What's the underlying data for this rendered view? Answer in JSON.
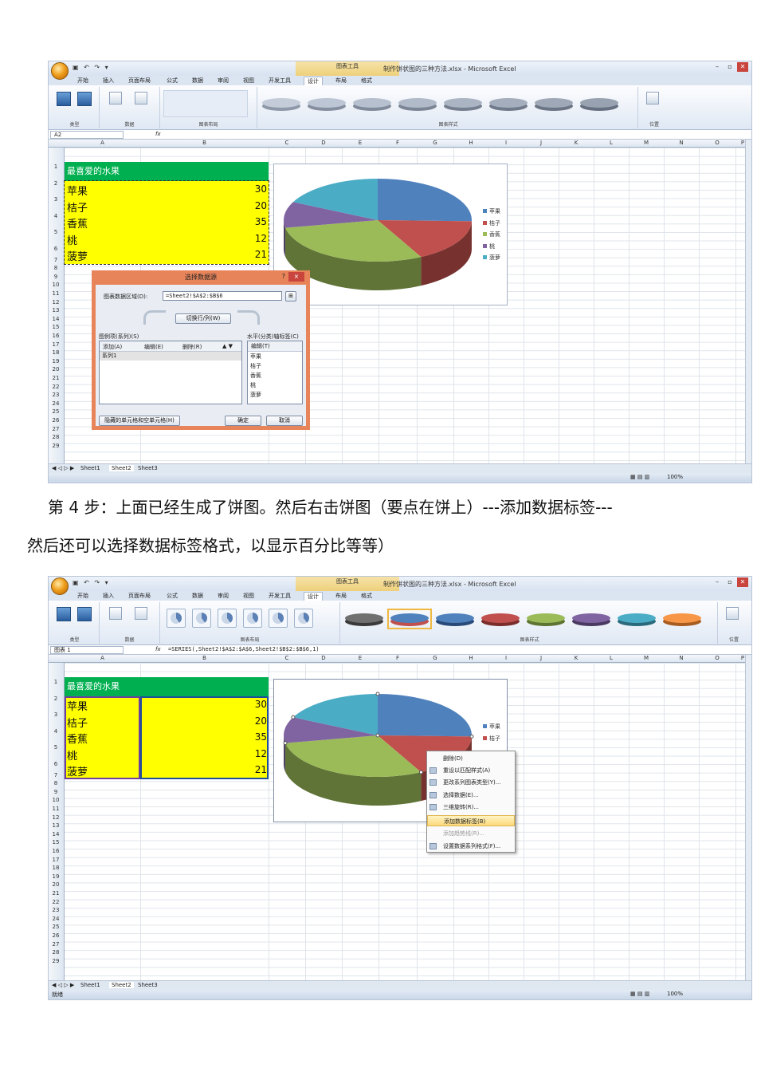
{
  "caption": {
    "line1": "第 4 步：上面已经生成了饼图。然后右击饼图（要点在饼上）---添加数据标签---",
    "line2": "然后还可以选择数据标签格式，以显示百分比等等）"
  },
  "excel": {
    "window_title": "制作饼状图的三种方法.xlsx - Microsoft Excel",
    "context_tool": "图表工具",
    "tabs": [
      "开始",
      "插入",
      "页面布局",
      "公式",
      "数据",
      "审阅",
      "视图",
      "开发工具",
      "设计",
      "布局",
      "格式"
    ],
    "active_tab": "设计",
    "ribbon_groups": [
      "类型",
      "数据",
      "图表布局",
      "图表样式",
      "位置"
    ],
    "ribbon_buttons": {
      "change_type": "更改图表类型",
      "save_template": "另存为模板",
      "switch_rowcol": "切换行/列",
      "select_data": "选择数据",
      "move_chart": "移动图表"
    },
    "columns": [
      "A",
      "B",
      "C",
      "D",
      "E",
      "F",
      "G",
      "H",
      "I",
      "J",
      "K",
      "L",
      "M",
      "N",
      "O",
      "P"
    ],
    "rows": [
      "1",
      "2",
      "3",
      "4",
      "5",
      "6",
      "7",
      "8",
      "9",
      "10",
      "11",
      "12",
      "13",
      "14",
      "15",
      "16",
      "17",
      "18",
      "19",
      "20",
      "21",
      "22",
      "23",
      "24",
      "25",
      "26",
      "27",
      "28",
      "29"
    ],
    "table_title": "最喜爱的水果",
    "fruits": [
      {
        "name": "苹果",
        "value": "30"
      },
      {
        "name": "桔子",
        "value": "20"
      },
      {
        "name": "香蕉",
        "value": "35"
      },
      {
        "name": "桃",
        "value": "12"
      },
      {
        "name": "菠萝",
        "value": "21"
      }
    ],
    "sheets": [
      "Sheet1",
      "Sheet2",
      "Sheet3"
    ],
    "status_ready": "就绪",
    "zoom": "100%",
    "colors": {
      "title_green": "#00b050",
      "data_yellow": "#ffff00",
      "accent": "#2a5d9e"
    }
  },
  "shot1": {
    "name_box": "A2",
    "formula": "",
    "legend": [
      "苹果",
      "桔子",
      "香蕉",
      "桃",
      "菠萝"
    ],
    "dialog": {
      "title": "选择数据源",
      "help": "?",
      "close": "×",
      "range_label": "图表数据区域(D):",
      "range_value": "=Sheet2!$A$2:$B$6",
      "switch_button": "切换行/列(W)",
      "series_label": "图例项(系列)(S)",
      "axis_label": "水平(分类)轴标签(C)",
      "add": "添加(A)",
      "edit": "编辑(E)",
      "delete": "删除(R)",
      "axis_edit": "编辑(T)",
      "series_items": [
        "系列1"
      ],
      "axis_items": [
        "苹果",
        "桔子",
        "香蕉",
        "桃",
        "菠萝"
      ],
      "hidden_cells": "隐藏的单元格和空单元格(H)",
      "ok": "确定",
      "cancel": "取消"
    }
  },
  "shot2": {
    "name_box": "图表 1",
    "formula": "=SERIES(,Sheet2!$A$2:$A$6,Sheet2!$B$2:$B$6,1)",
    "legend": [
      "苹果",
      "桔子"
    ],
    "context_menu": [
      {
        "label": "删除(D)",
        "state": "normal"
      },
      {
        "label": "重设以匹配样式(A)",
        "state": "normal"
      },
      {
        "label": "更改系列图表类型(Y)...",
        "state": "normal"
      },
      {
        "label": "选择数据(E)...",
        "state": "normal"
      },
      {
        "label": "三维旋转(R)...",
        "state": "normal"
      },
      {
        "label": "添加数据标签(B)",
        "state": "highlight"
      },
      {
        "label": "添加趋势线(R)...",
        "state": "disabled"
      },
      {
        "label": "设置数据系列格式(F)...",
        "state": "normal"
      }
    ]
  },
  "chart_data": {
    "type": "pie",
    "categories": [
      "苹果",
      "桔子",
      "香蕉",
      "桃",
      "菠萝"
    ],
    "values": [
      30,
      20,
      35,
      12,
      21
    ],
    "colors": [
      "#4f81bd",
      "#c0504d",
      "#9bbb59",
      "#8064a2",
      "#4bacc6"
    ],
    "title": "",
    "legend": "right"
  }
}
